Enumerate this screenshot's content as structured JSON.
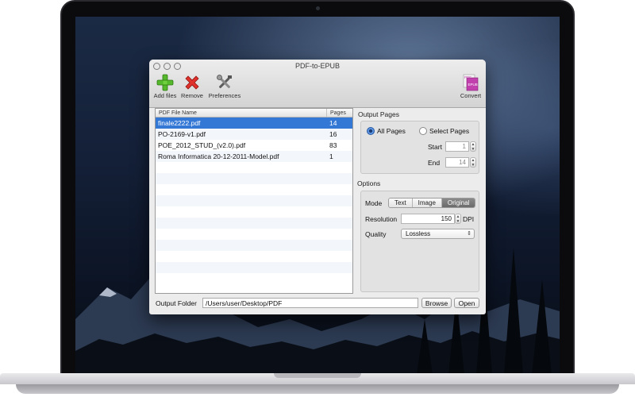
{
  "window": {
    "title": "PDF-to-EPUB"
  },
  "toolbar": {
    "add_label": "Add files",
    "remove_label": "Remove",
    "preferences_label": "Preferences",
    "convert_label": "Convert",
    "convert_icon_text_top": "PDF",
    "convert_icon_text_bottom": "EPUB"
  },
  "file_list": {
    "columns": [
      "PDF File Name",
      "Pages"
    ],
    "rows": [
      {
        "name": "finale2222.pdf",
        "pages": "14",
        "selected": true
      },
      {
        "name": "PO-2169-v1.pdf",
        "pages": "16",
        "selected": false
      },
      {
        "name": "POE_2012_STUD_(v2.0).pdf",
        "pages": "83",
        "selected": false
      },
      {
        "name": "Roma Informatica 20-12-2011-Model.pdf",
        "pages": "1",
        "selected": false
      }
    ],
    "empty_rows": 10
  },
  "output_pages": {
    "section_label": "Output Pages",
    "all_pages_label": "All Pages",
    "select_pages_label": "Select Pages",
    "selected": "all",
    "start_label": "Start",
    "start_value": "1",
    "end_label": "End",
    "end_value": "14"
  },
  "options": {
    "section_label": "Options",
    "mode_label": "Mode",
    "modes": [
      "Text",
      "Image",
      "Original"
    ],
    "active_mode": "Original",
    "resolution_label": "Resolution",
    "resolution_value": "150",
    "resolution_unit": "DPI",
    "quality_label": "Quality",
    "quality_value": "Lossless"
  },
  "output": {
    "label": "Output Folder",
    "path": "/Users/user/Desktop/PDF",
    "browse_label": "Browse",
    "open_label": "Open"
  }
}
